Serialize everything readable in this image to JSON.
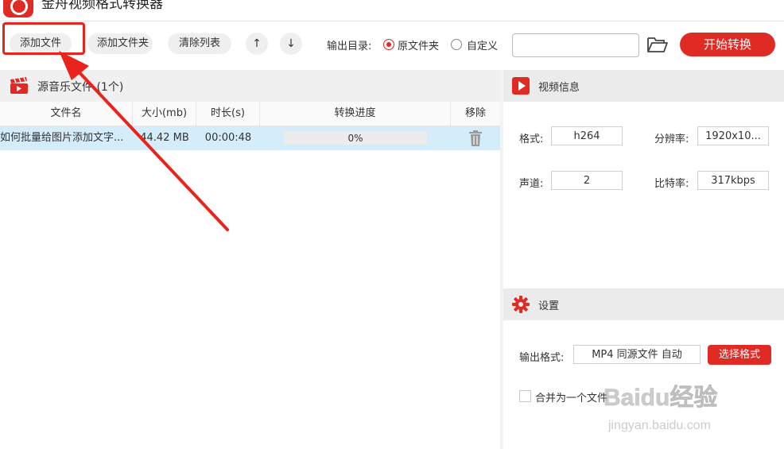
{
  "app": {
    "title": "金舟视频格式转换器",
    "logo_icon": "app-logo-icon"
  },
  "toolbar": {
    "add_file": "添加文件",
    "add_folder": "添加文件夹",
    "clear_list": "清除列表",
    "move_up_icon": "arrow-up-icon",
    "move_down_icon": "arrow-down-icon",
    "output_dir_label": "输出目录:",
    "option_source": "原文件夹",
    "option_custom": "自定义",
    "selected_option": "原文件夹",
    "path_value": "",
    "folder_icon": "folder-open-icon",
    "start": "开始转换"
  },
  "file_panel": {
    "title": "源音乐文件 (1个)",
    "columns": [
      "文件名",
      "大小(mb)",
      "时长(s)",
      "转换进度",
      "移除"
    ],
    "rows": [
      {
        "name": "如何批量给图片添加文字...",
        "size": "44.42 MB",
        "duration": "00:00:48",
        "progress": "0%",
        "progress_fraction": 0,
        "remove_icon": "trash-icon"
      }
    ]
  },
  "video_info": {
    "title": "视频信息",
    "format_label": "格式:",
    "format_value": "h264",
    "resolution_label": "分辨率:",
    "resolution_value": "1920x10...",
    "channel_label": "声道:",
    "channel_value": "2",
    "bitrate_label": "比特率:",
    "bitrate_value": "317kbps"
  },
  "settings": {
    "title": "设置",
    "output_format_label": "输出格式:",
    "output_format_value": "MP4 同源文件 自动",
    "choose_format": "选择格式",
    "merge_label": "合并为一个文件",
    "merge_checked": false
  },
  "watermark": {
    "brand": "Baidu经验",
    "url": "jingyan.baidu.com"
  },
  "colors": {
    "accent": "#e02a24",
    "selected_row": "#d5ecfa",
    "annotation": "#e8241c"
  }
}
